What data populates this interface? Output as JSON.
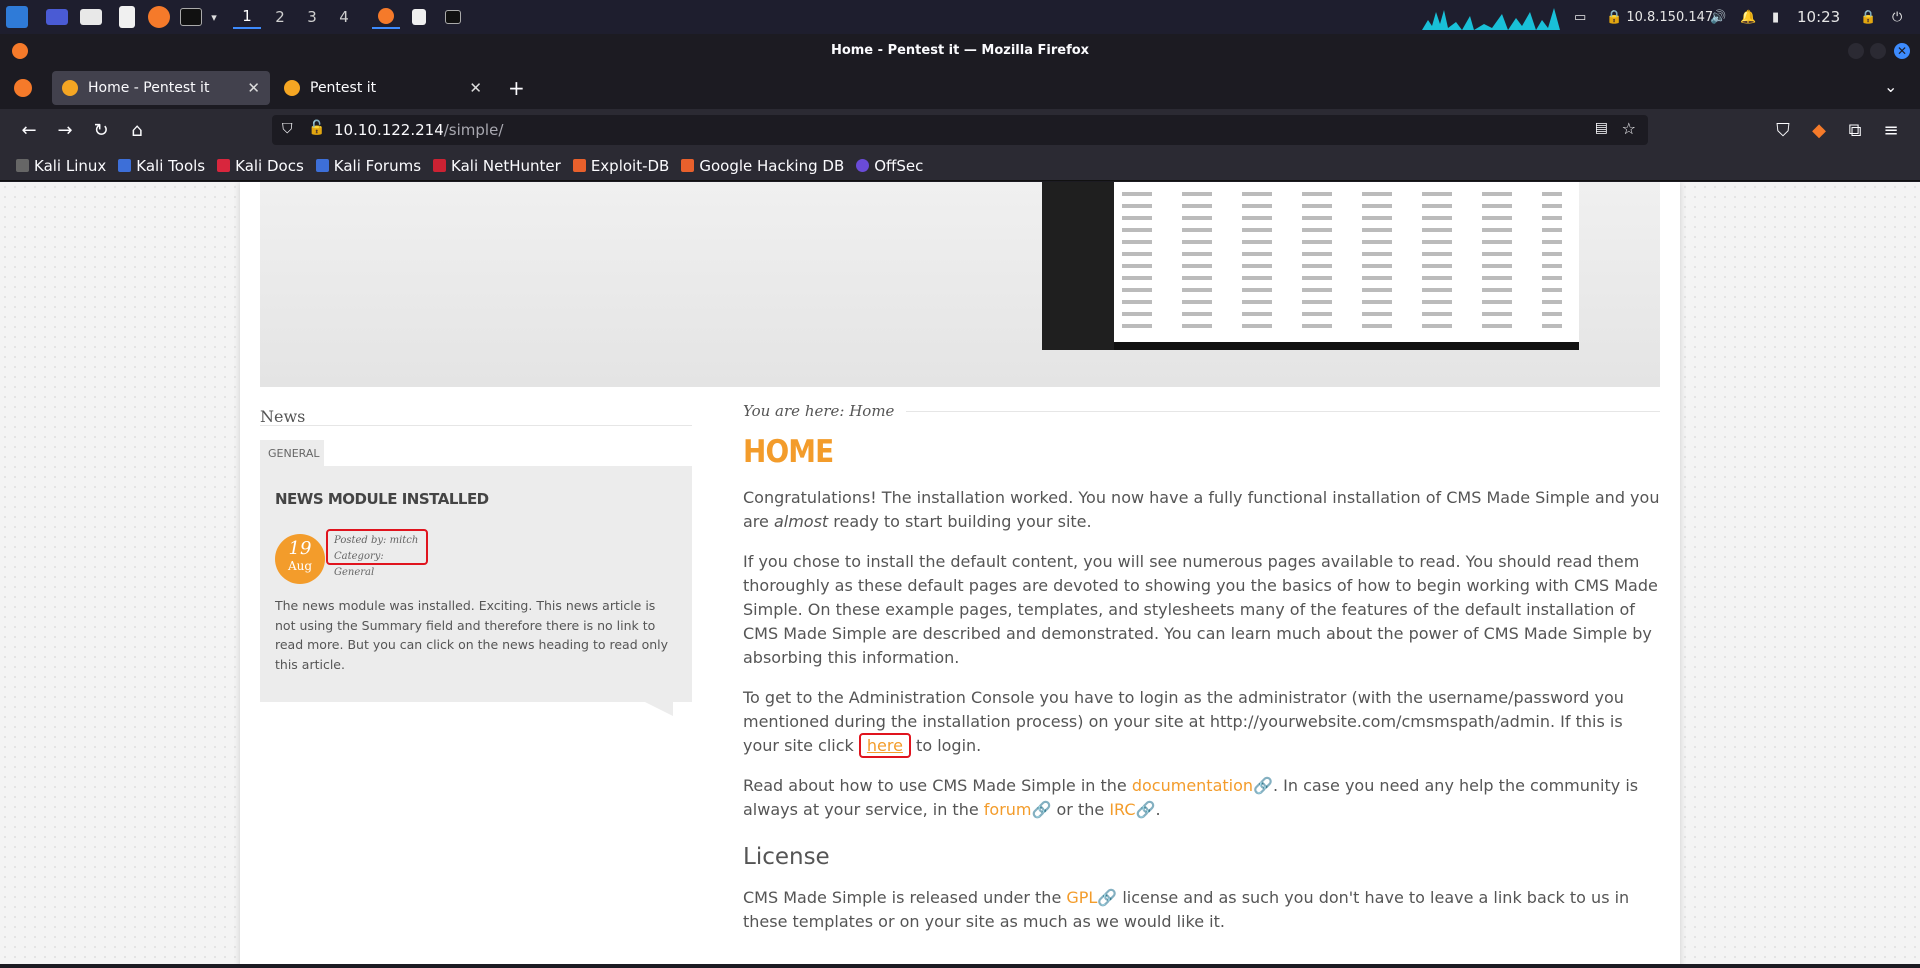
{
  "taskbar": {
    "workspaces": [
      "1",
      "2",
      "3",
      "4"
    ],
    "ip": "10.8.150.147",
    "time": "10:23"
  },
  "window": {
    "title": "Home - Pentest it — Mozilla Firefox"
  },
  "tabs": [
    {
      "label": "Home - Pentest it",
      "active": true
    },
    {
      "label": "Pentest it",
      "active": false
    }
  ],
  "url": {
    "host": "10.10.122.214",
    "path": "/simple/"
  },
  "bookmarks": [
    "Kali Linux",
    "Kali Tools",
    "Kali Docs",
    "Kali Forums",
    "Kali NetHunter",
    "Exploit-DB",
    "Google Hacking DB",
    "OffSec"
  ],
  "sidebar": {
    "title": "News",
    "category_tab": "GENERAL",
    "article_title": "NEWS MODULE INSTALLED",
    "date_day": "19",
    "date_month": "Aug",
    "posted_by": "Posted by: mitch",
    "category": "Category: General",
    "text": "The news module was installed. Exciting. This news article is not using the Summary field and therefore there is no link to read more. But you can click on the news heading to read only this article."
  },
  "main": {
    "breadcrumb": "You are here: Home",
    "heading": "HOME",
    "p1_a": "Congratulations! The installation worked. You now have a fully functional installation of CMS Made Simple and you are ",
    "p1_em": "almost",
    "p1_b": " ready to start building your site.",
    "p2": "If you chose to install the default content, you will see numerous pages available to read. You should read them thoroughly as these default pages are devoted to showing you the basics of how to begin working with CMS Made Simple. On these example pages, templates, and stylesheets many of the features of the default installation of CMS Made Simple are described and demonstrated. You can learn much about the power of CMS Made Simple by absorbing this information.",
    "p3_a": "To get to the Administration Console you have to login as the administrator (with the username/password you mentioned during the installation process) on your site at http://yourwebsite.com/cmsmspath/admin. If this is your site click ",
    "p3_link": "here",
    "p3_b": " to login.",
    "p4_a": "Read about how to use CMS Made Simple in the ",
    "p4_doc": "documentation",
    "p4_b": ". In case you need any help the community is always at your service, in the ",
    "p4_forum": "forum",
    "p4_c": " or the ",
    "p4_irc": "IRC",
    "p4_d": ".",
    "license_heading": "License",
    "p5_a": "CMS Made Simple is released under the ",
    "p5_gpl": "GPL",
    "p5_b": " license and as such you don't have to leave a link back to us in these templates or on your site as much as we would like it."
  }
}
